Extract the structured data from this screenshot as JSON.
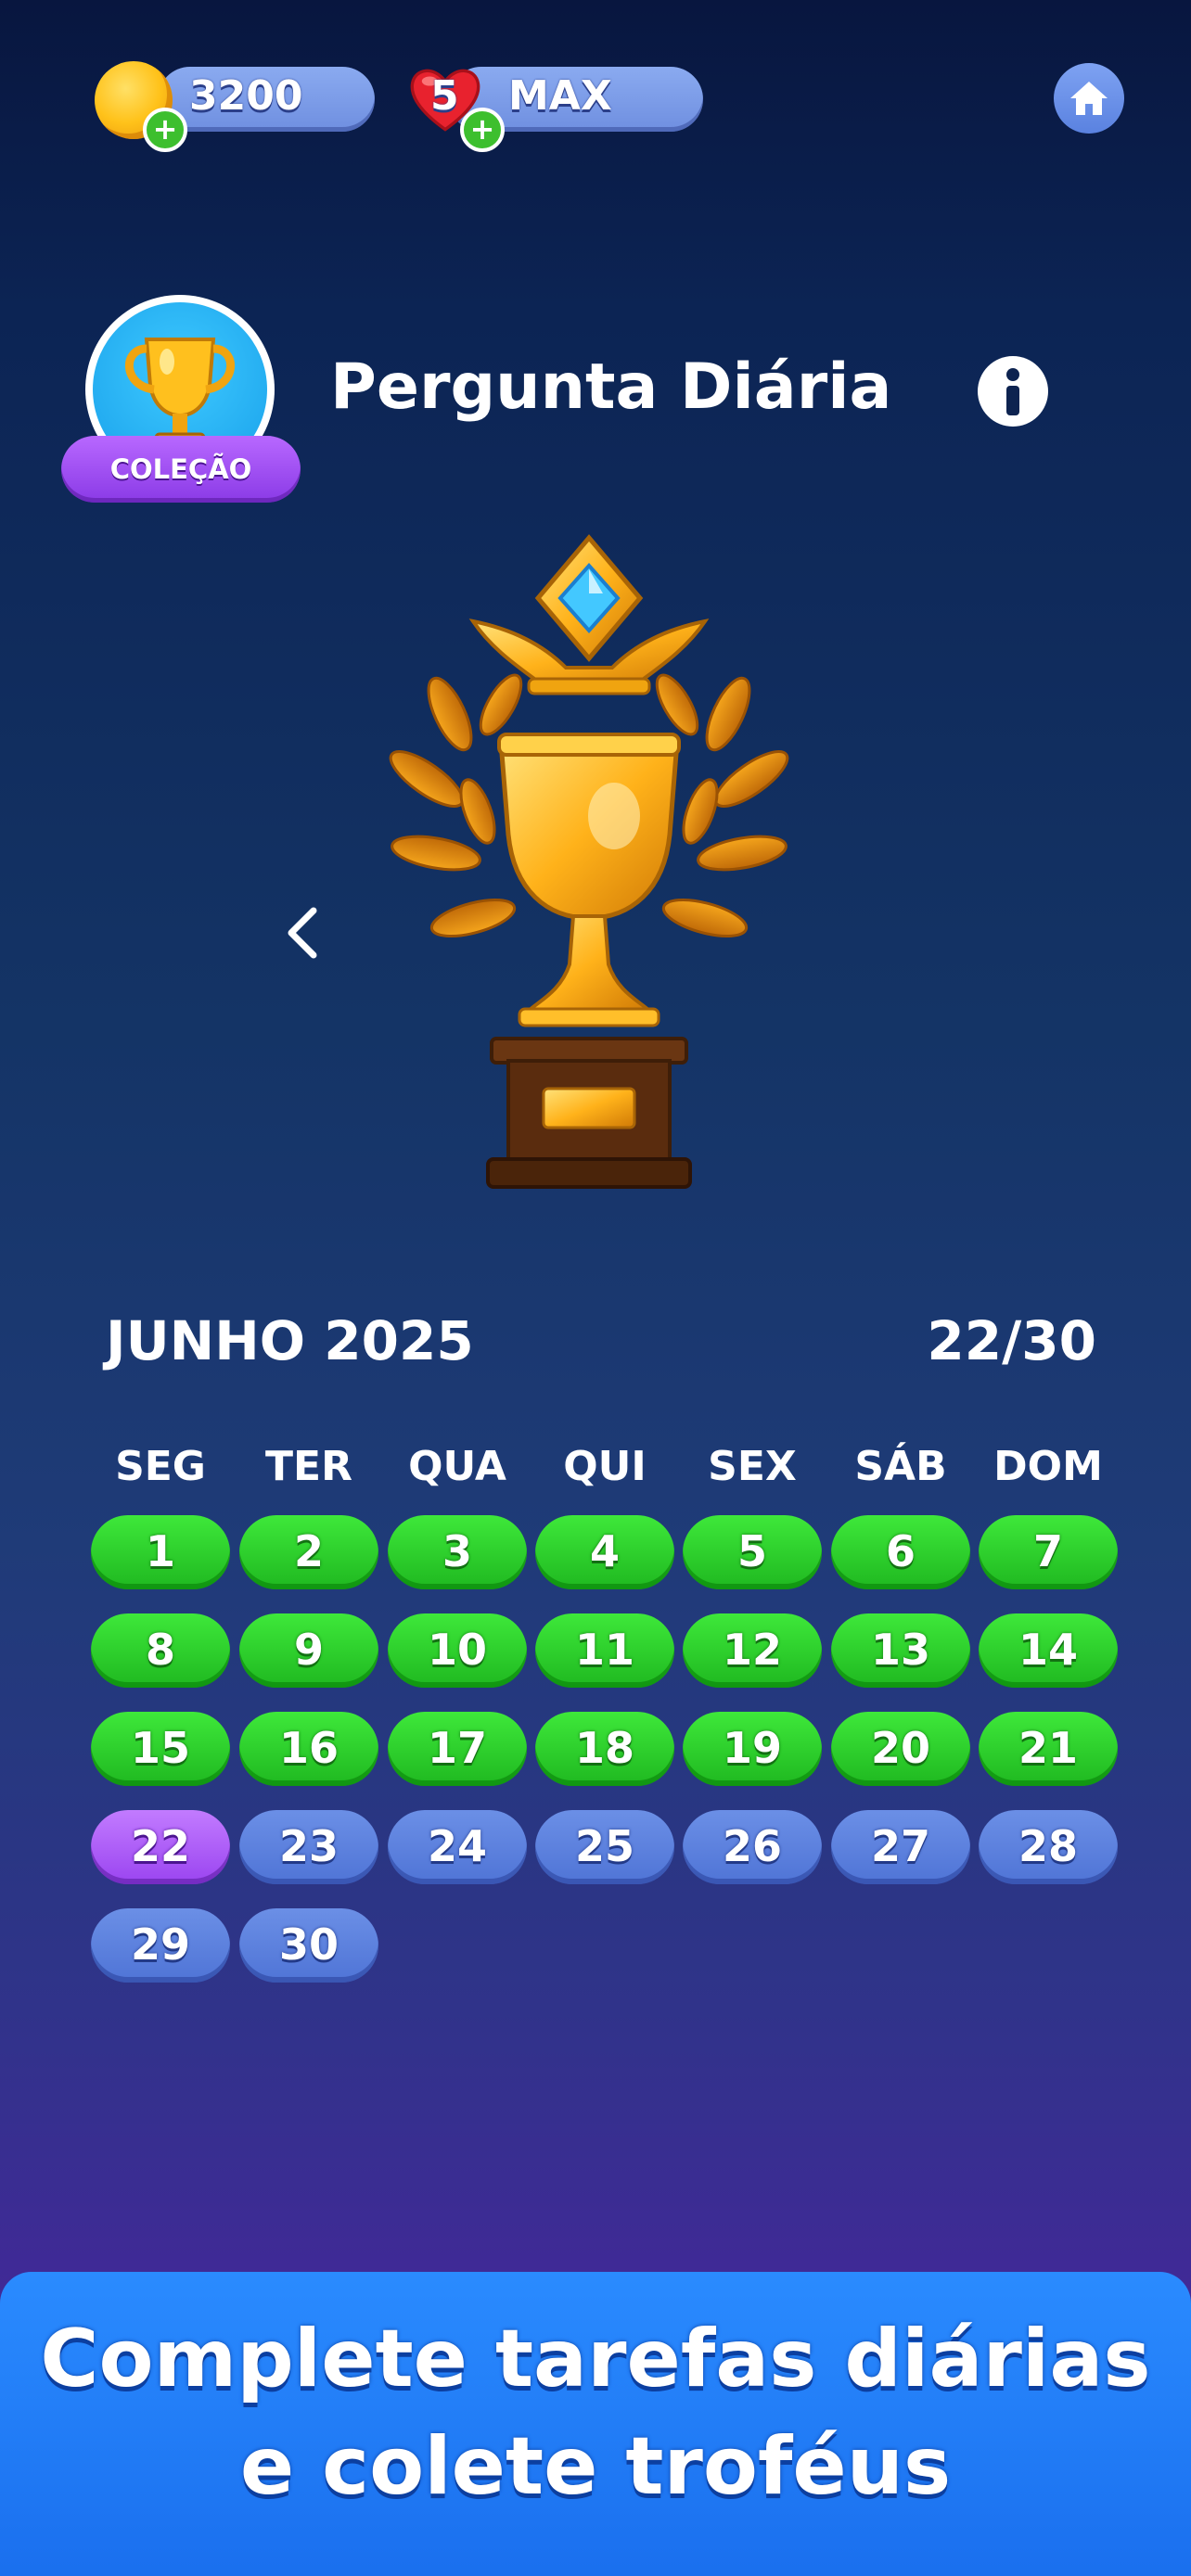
{
  "top_bar": {
    "coins": "3200",
    "lives_count": "5",
    "lives_label": "MAX",
    "plus_symbol": "+"
  },
  "header": {
    "title": "Pergunta Diária",
    "collection_badge": "COLEÇÃO",
    "info_icon": "info-icon"
  },
  "calendar": {
    "month": "JUNHO 2025",
    "progress": "22/30",
    "weekdays": [
      "SEG",
      "TER",
      "QUA",
      "QUI",
      "SEX",
      "SÁB",
      "DOM"
    ],
    "days": [
      {
        "label": "1",
        "status": "done"
      },
      {
        "label": "2",
        "status": "done"
      },
      {
        "label": "3",
        "status": "done"
      },
      {
        "label": "4",
        "status": "done"
      },
      {
        "label": "5",
        "status": "done"
      },
      {
        "label": "6",
        "status": "done"
      },
      {
        "label": "7",
        "status": "done"
      },
      {
        "label": "8",
        "status": "done"
      },
      {
        "label": "9",
        "status": "done"
      },
      {
        "label": "10",
        "status": "done"
      },
      {
        "label": "11",
        "status": "done"
      },
      {
        "label": "12",
        "status": "done"
      },
      {
        "label": "13",
        "status": "done"
      },
      {
        "label": "14",
        "status": "done"
      },
      {
        "label": "15",
        "status": "done"
      },
      {
        "label": "16",
        "status": "done"
      },
      {
        "label": "17",
        "status": "done"
      },
      {
        "label": "18",
        "status": "done"
      },
      {
        "label": "19",
        "status": "done"
      },
      {
        "label": "20",
        "status": "done"
      },
      {
        "label": "21",
        "status": "done"
      },
      {
        "label": "22",
        "status": "today"
      },
      {
        "label": "23",
        "status": "todo"
      },
      {
        "label": "24",
        "status": "todo"
      },
      {
        "label": "25",
        "status": "todo"
      },
      {
        "label": "26",
        "status": "todo"
      },
      {
        "label": "27",
        "status": "todo"
      },
      {
        "label": "28",
        "status": "todo"
      },
      {
        "label": "29",
        "status": "todo"
      },
      {
        "label": "30",
        "status": "todo"
      }
    ]
  },
  "banner": {
    "line1": "Complete tarefas diárias",
    "line2": "e colete troféus"
  },
  "colors": {
    "done": "#22c424",
    "today": "#a24ff2",
    "todo": "#587ddc",
    "banner": "#1f7af5"
  }
}
